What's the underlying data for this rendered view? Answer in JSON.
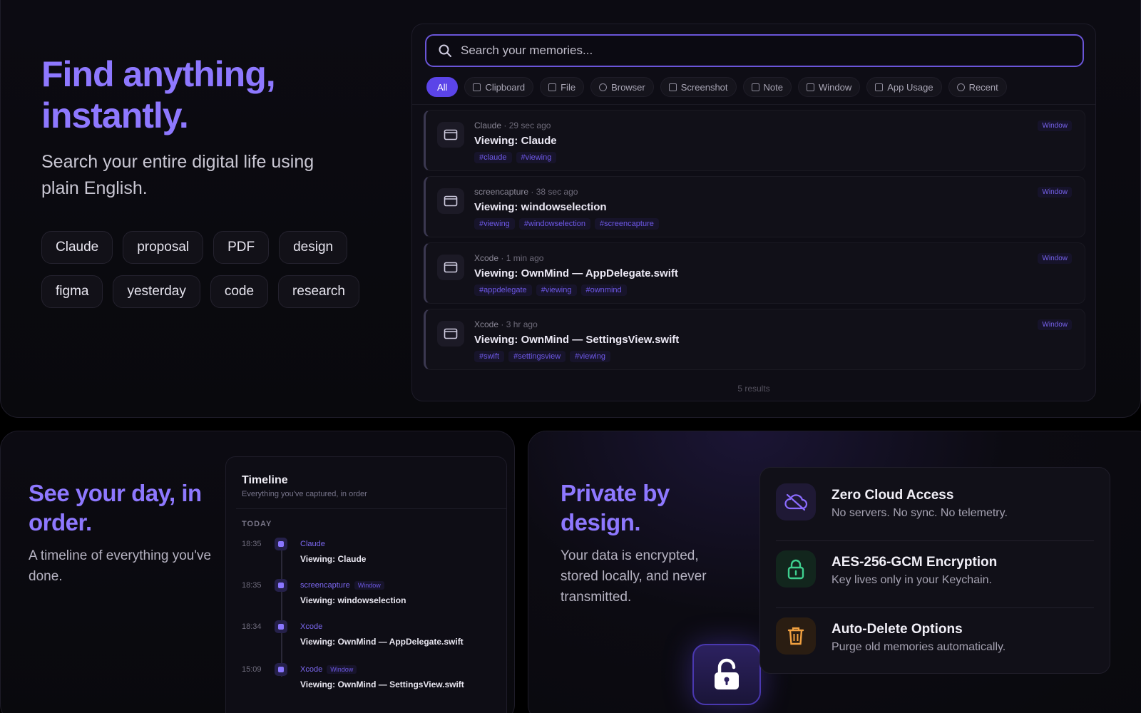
{
  "hero": {
    "title": "Find anything, instantly.",
    "subtitle": "Search your entire digital life using plain English.",
    "chips": [
      "Claude",
      "proposal",
      "PDF",
      "design",
      "figma",
      "yesterday",
      "code",
      "research"
    ]
  },
  "search": {
    "placeholder": "Search your memories...",
    "filters": [
      "All",
      "Clipboard",
      "File",
      "Browser",
      "Screenshot",
      "Note",
      "Window",
      "App Usage",
      "Recent"
    ],
    "results": [
      {
        "app": "Claude",
        "time": "29 sec ago",
        "title": "Viewing: Claude",
        "tags": [
          "#claude",
          "#viewing"
        ],
        "badge": "Window"
      },
      {
        "app": "screencapture",
        "time": "38 sec ago",
        "title": "Viewing: windowselection",
        "tags": [
          "#viewing",
          "#windowselection",
          "#screencapture"
        ],
        "badge": "Window"
      },
      {
        "app": "Xcode",
        "time": "1 min ago",
        "title": "Viewing: OwnMind — AppDelegate.swift",
        "tags": [
          "#appdelegate",
          "#viewing",
          "#ownmind"
        ],
        "badge": "Window"
      },
      {
        "app": "Xcode",
        "time": "3 hr ago",
        "title": "Viewing: OwnMind — SettingsView.swift",
        "tags": [
          "#swift",
          "#settingsview",
          "#viewing"
        ],
        "badge": "Window"
      }
    ],
    "count": "5 results",
    "meta_separator": "·"
  },
  "timeline_section": {
    "title": "See your day, in order.",
    "subtitle": "A timeline of everything you've done.",
    "panel_title": "Timeline",
    "panel_subtitle": "Everything you've captured, in order",
    "group": "TODAY",
    "items": [
      {
        "time": "18:35",
        "app": "Claude",
        "badge": "",
        "title": "Viewing: Claude"
      },
      {
        "time": "18:35",
        "app": "screencapture",
        "badge": "Window",
        "title": "Viewing: windowselection"
      },
      {
        "time": "18:34",
        "app": "Xcode",
        "badge": "",
        "title": "Viewing: OwnMind — AppDelegate.swift"
      },
      {
        "time": "15:09",
        "app": "Xcode",
        "badge": "Window",
        "title": "Viewing: OwnMind — SettingsView.swift"
      }
    ]
  },
  "privacy": {
    "title": "Private by design.",
    "subtitle": "Your data is encrypted, stored locally, and never transmitted.",
    "features": [
      {
        "icon": "cloud-off-icon",
        "title": "Zero Cloud Access",
        "desc": "No servers. No sync. No telemetry.",
        "color": "#8b6cff"
      },
      {
        "icon": "lock-icon",
        "title": "AES-256-GCM Encryption",
        "desc": "Key lives only in your Keychain.",
        "color": "#3ecf8e"
      },
      {
        "icon": "trash-icon",
        "title": "Auto-Delete Options",
        "desc": "Purge old memories automatically.",
        "color": "#f0a040"
      }
    ]
  },
  "colors": {
    "accent": "#8e78ff",
    "active_filter": "#5b44e8"
  }
}
